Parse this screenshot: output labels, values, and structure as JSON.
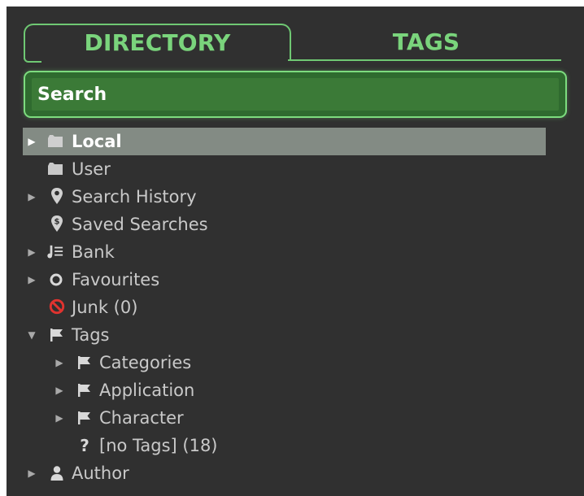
{
  "tabs": {
    "directory": "DIRECTORY",
    "tags": "TAGS"
  },
  "search": {
    "placeholder": "Search"
  },
  "tree": {
    "local": "Local",
    "user": "User",
    "search_history": "Search History",
    "saved_searches": "Saved Searches",
    "bank": "Bank",
    "favourites": "Favourites",
    "junk": "Junk (0)",
    "tags": "Tags",
    "categories": "Categories",
    "application": "Application",
    "character": "Character",
    "no_tags": "[no Tags] (18)",
    "author": "Author"
  },
  "icons": {
    "local": "folder-icon",
    "user": "folder-icon",
    "search_history": "location-pin-icon",
    "saved_searches": "dollar-pin-icon",
    "bank": "bank-icon",
    "favourites": "circle-icon",
    "junk": "prohibited-icon",
    "tags": "flag-icon",
    "no_tags": "question-icon",
    "author": "person-icon"
  },
  "colors": {
    "panel_background": "#303030",
    "accent_green": "#6fc873",
    "search_fill": "#3b7a37",
    "selection": "#838b84",
    "junk_red": "#e0332f"
  }
}
